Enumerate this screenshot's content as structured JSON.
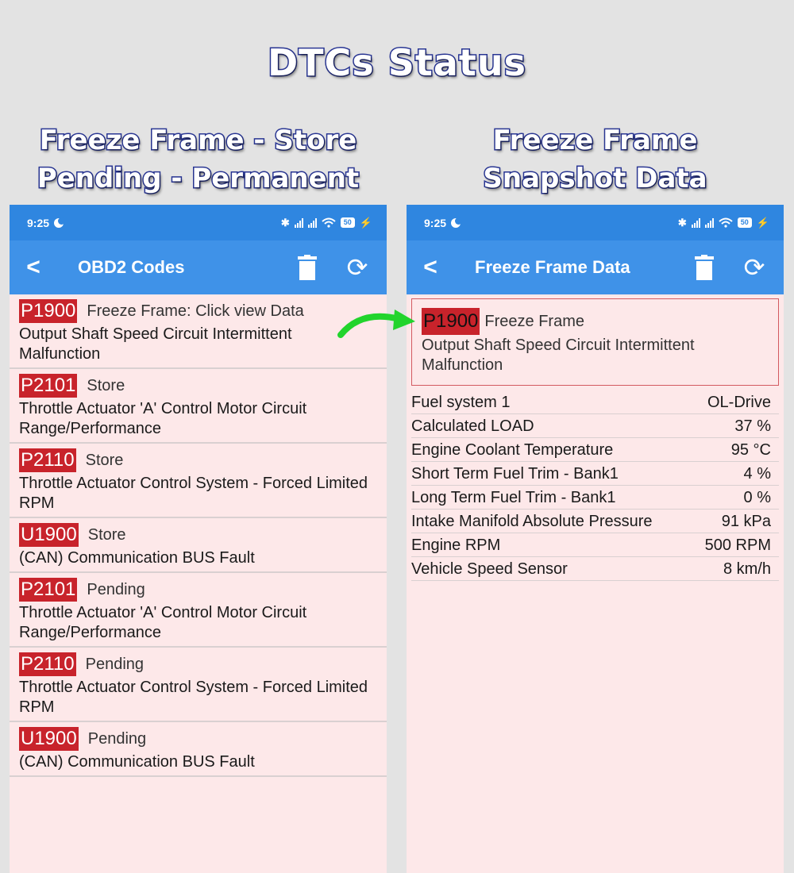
{
  "headline": "DTCs Status",
  "subtitle_left": [
    "Freeze Frame - Store",
    "Pending - Permanent"
  ],
  "subtitle_right": [
    "Freeze Frame",
    "Snapshot Data"
  ],
  "status_bar": {
    "time": "9:25",
    "battery": "50"
  },
  "left_phone": {
    "title": "OBD2 Codes",
    "codes": [
      {
        "code": "P1900",
        "status": "Freeze Frame: Click view Data",
        "description": "Output Shaft Speed Circuit Intermittent Malfunction"
      },
      {
        "code": "P2101",
        "status": "Store",
        "description": "Throttle Actuator 'A' Control Motor Circuit Range/Performance"
      },
      {
        "code": "P2110",
        "status": "Store",
        "description": "Throttle Actuator Control System - Forced Limited RPM"
      },
      {
        "code": "U1900",
        "status": "Store",
        "description": "(CAN) Communication BUS Fault"
      },
      {
        "code": "P2101",
        "status": "Pending",
        "description": "Throttle Actuator 'A' Control Motor Circuit Range/Performance"
      },
      {
        "code": "P2110",
        "status": "Pending",
        "description": "Throttle Actuator Control System - Forced Limited RPM"
      },
      {
        "code": "U1900",
        "status": "Pending",
        "description": "(CAN) Communication BUS Fault"
      }
    ]
  },
  "right_phone": {
    "title": "Freeze Frame Data",
    "code": "P1900",
    "label": "Freeze Frame",
    "description": "Output Shaft Speed Circuit Intermittent Malfunction",
    "pids": [
      {
        "name": "Fuel system 1",
        "value": "OL-Drive"
      },
      {
        "name": "Calculated LOAD",
        "value": "37 %"
      },
      {
        "name": "Engine Coolant Temperature",
        "value": "95 °C"
      },
      {
        "name": "Short Term Fuel Trim - Bank1",
        "value": "4 %"
      },
      {
        "name": "Long Term Fuel Trim - Bank1",
        "value": "0 %"
      },
      {
        "name": "Intake Manifold Absolute Pressure",
        "value": "91 kPa"
      },
      {
        "name": "Engine RPM",
        "value": "500 RPM"
      },
      {
        "name": "Vehicle Speed Sensor",
        "value": "8 km/h"
      }
    ]
  },
  "icons": [
    "back-arrow-icon",
    "trash-icon",
    "refresh-icon",
    "bluetooth-icon",
    "signal-icon",
    "wifi-icon",
    "battery-icon",
    "charging-icon",
    "moon-icon",
    "green-arrow-icon"
  ],
  "colors": {
    "accent": "#3f92e8",
    "status_bar": "#2f86e0",
    "code_bg": "#c8232b",
    "list_bg": "#fde8e9",
    "arrow": "#22d42c"
  }
}
